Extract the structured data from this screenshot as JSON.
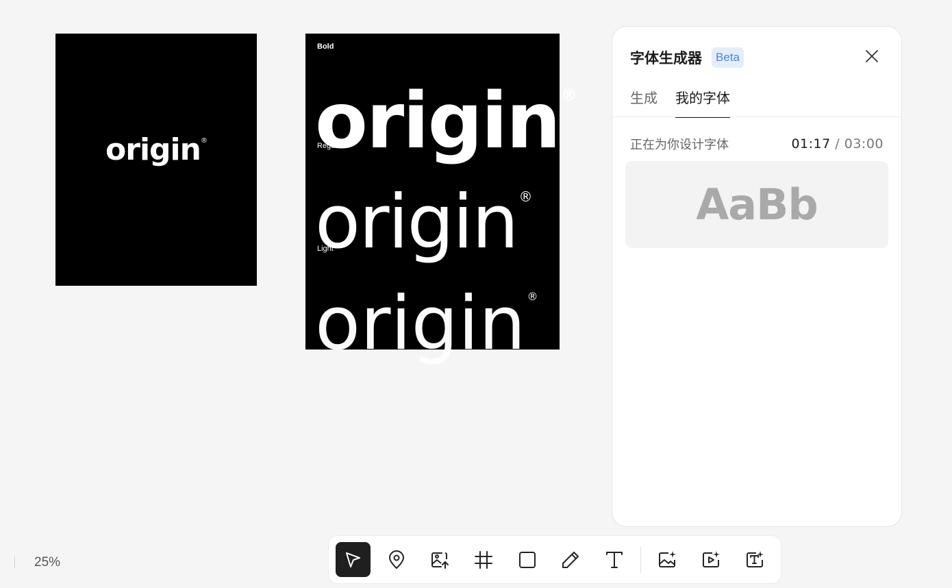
{
  "canvas": {
    "artboard1": {
      "logo": "origin",
      "registered": "®"
    },
    "artboard2": {
      "rows": [
        {
          "label": "Bold",
          "logo": "origin",
          "registered": "®"
        },
        {
          "label": "Regular",
          "logo": "origin",
          "registered": "®"
        },
        {
          "label": "Light",
          "logo": "origin",
          "registered": "®"
        }
      ]
    }
  },
  "panel": {
    "title": "字体生成器",
    "badge": "Beta",
    "tabs": [
      {
        "label": "生成",
        "active": false
      },
      {
        "label": "我的字体",
        "active": true
      }
    ],
    "status_text": "正在为你设计字体",
    "timer": {
      "elapsed": "01:17",
      "separator": "/",
      "total": "03:00"
    },
    "preview_text": "AaBb"
  },
  "zoom": {
    "level": "25%"
  },
  "toolbar": {
    "tools": [
      {
        "icon": "pointer-icon",
        "active": true
      },
      {
        "icon": "map-pin-icon",
        "active": false
      },
      {
        "icon": "image-upload-icon",
        "active": false
      },
      {
        "icon": "frame-hash-icon",
        "active": false
      },
      {
        "icon": "rectangle-icon",
        "active": false
      },
      {
        "icon": "pencil-icon",
        "active": false
      },
      {
        "icon": "text-icon",
        "active": false
      },
      {
        "icon": "ai-image-icon",
        "active": false
      },
      {
        "icon": "ai-video-icon",
        "active": false
      },
      {
        "icon": "ai-text-icon",
        "active": false
      }
    ]
  },
  "colors": {
    "background": "#f5f5f5",
    "artboard": "#000000",
    "accent_badge_bg": "#e4eefb",
    "accent_badge_text": "#4a86d8",
    "active_tool": "#1f1f1f"
  }
}
